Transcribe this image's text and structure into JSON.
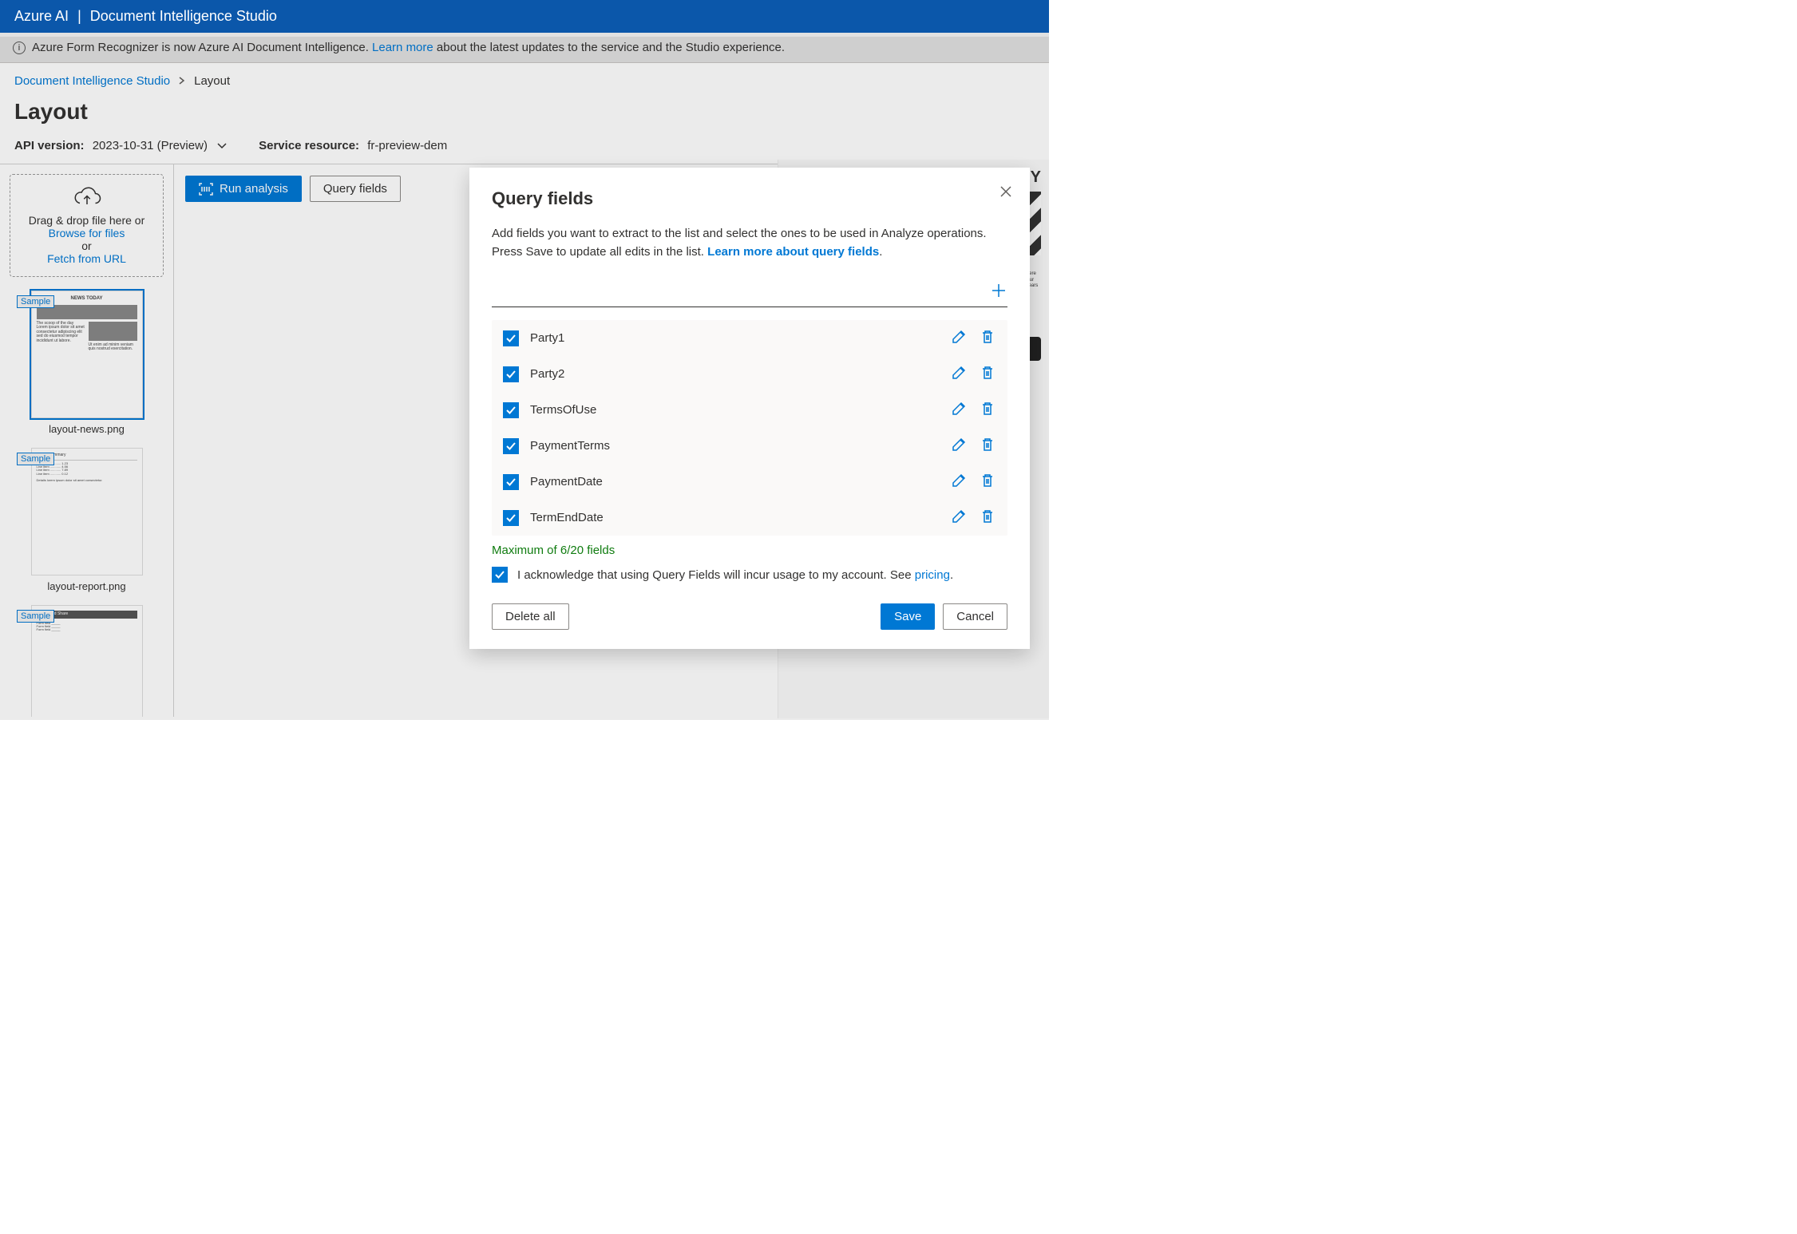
{
  "header": {
    "brand": "Azure AI",
    "product": "Document Intelligence Studio"
  },
  "banner": {
    "text_pre": "Azure Form Recognizer is now Azure AI Document Intelligence. ",
    "link": "Learn more",
    "text_post": " about the latest updates to the service and the Studio experience."
  },
  "breadcrumb": {
    "root": "Document Intelligence Studio",
    "current": "Layout"
  },
  "page_title": "Layout",
  "meta": {
    "api_label": "API version:",
    "api_value": "2023-10-31 (Preview)",
    "resource_label": "Service resource:",
    "resource_value": "fr-preview-dem"
  },
  "dropzone": {
    "line1": "Drag & drop file here or",
    "browse": "Browse for files",
    "or": "or",
    "fetch": "Fetch from URL"
  },
  "thumbs": [
    {
      "badge": "Sample",
      "name": "layout-news.png",
      "selected": true,
      "headline": "NEWS TODAY"
    },
    {
      "badge": "Sample",
      "name": "layout-report.png",
      "selected": false,
      "headline": ""
    },
    {
      "badge": "Sample",
      "name": "",
      "selected": false,
      "headline": ""
    }
  ],
  "toolbar": {
    "run": "Run analysis",
    "query": "Query fields"
  },
  "modal": {
    "title": "Query fields",
    "desc_pre": "Add fields you want to extract to the list and select the ones to be used in Analyze operations. Press Save to update all edits in the list. ",
    "desc_link": "Learn more about query fields",
    "fields": [
      {
        "name": "Party1",
        "checked": true
      },
      {
        "name": "Party2",
        "checked": true
      },
      {
        "name": "TermsOfUse",
        "checked": true
      },
      {
        "name": "PaymentTerms",
        "checked": true
      },
      {
        "name": "PaymentDate",
        "checked": true
      },
      {
        "name": "TermEndDate",
        "checked": true
      }
    ],
    "max_note": "Maximum of 6/20 fields",
    "ack_text": "I acknowledge that using Query Fields will incur usage to my account. See ",
    "ack_link": "pricing",
    "delete_all": "Delete all",
    "save": "Save",
    "cancel": "Cancel"
  }
}
